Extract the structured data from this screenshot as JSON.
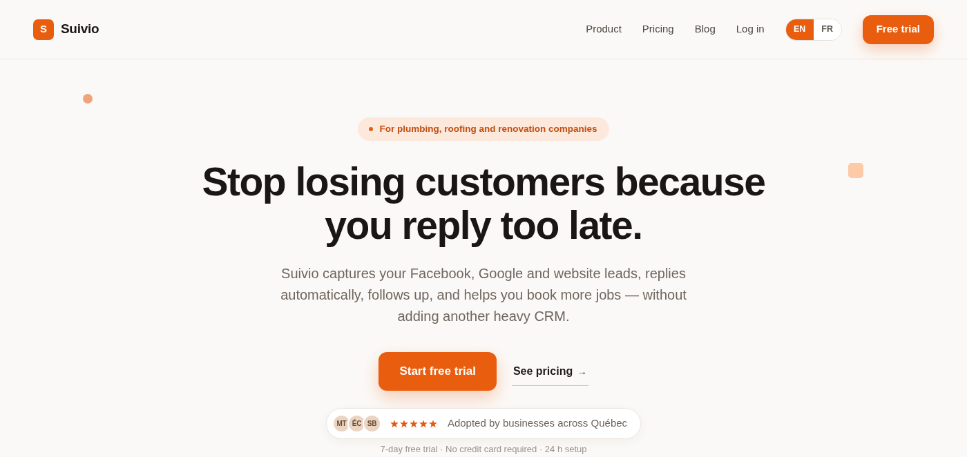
{
  "brand": {
    "mark": "S",
    "name": "Suivio"
  },
  "nav": {
    "links": [
      "Product",
      "Pricing",
      "Blog",
      "Log in"
    ],
    "languages": [
      {
        "label": "EN",
        "selected": true
      },
      {
        "label": "FR",
        "selected": false
      }
    ],
    "cta": "Free trial"
  },
  "hero": {
    "badge": "For plumbing, roofing and renovation companies",
    "title": "Stop losing customers because you reply too late.",
    "subtitle": "Suivio captures your Facebook, Google and website leads, replies automatically, follows up, and helps you book more jobs — without adding another heavy CRM.",
    "primary_button": "Start free trial",
    "secondary_link": {
      "label": "See pricing",
      "arrow": "→"
    },
    "proof": {
      "avatars": [
        "MT",
        "ÉC",
        "SB"
      ],
      "stars": 5,
      "text": "Adopted by businesses across Québec"
    },
    "footnote": "7-day free trial · No credit card required · 24 h setup"
  }
}
